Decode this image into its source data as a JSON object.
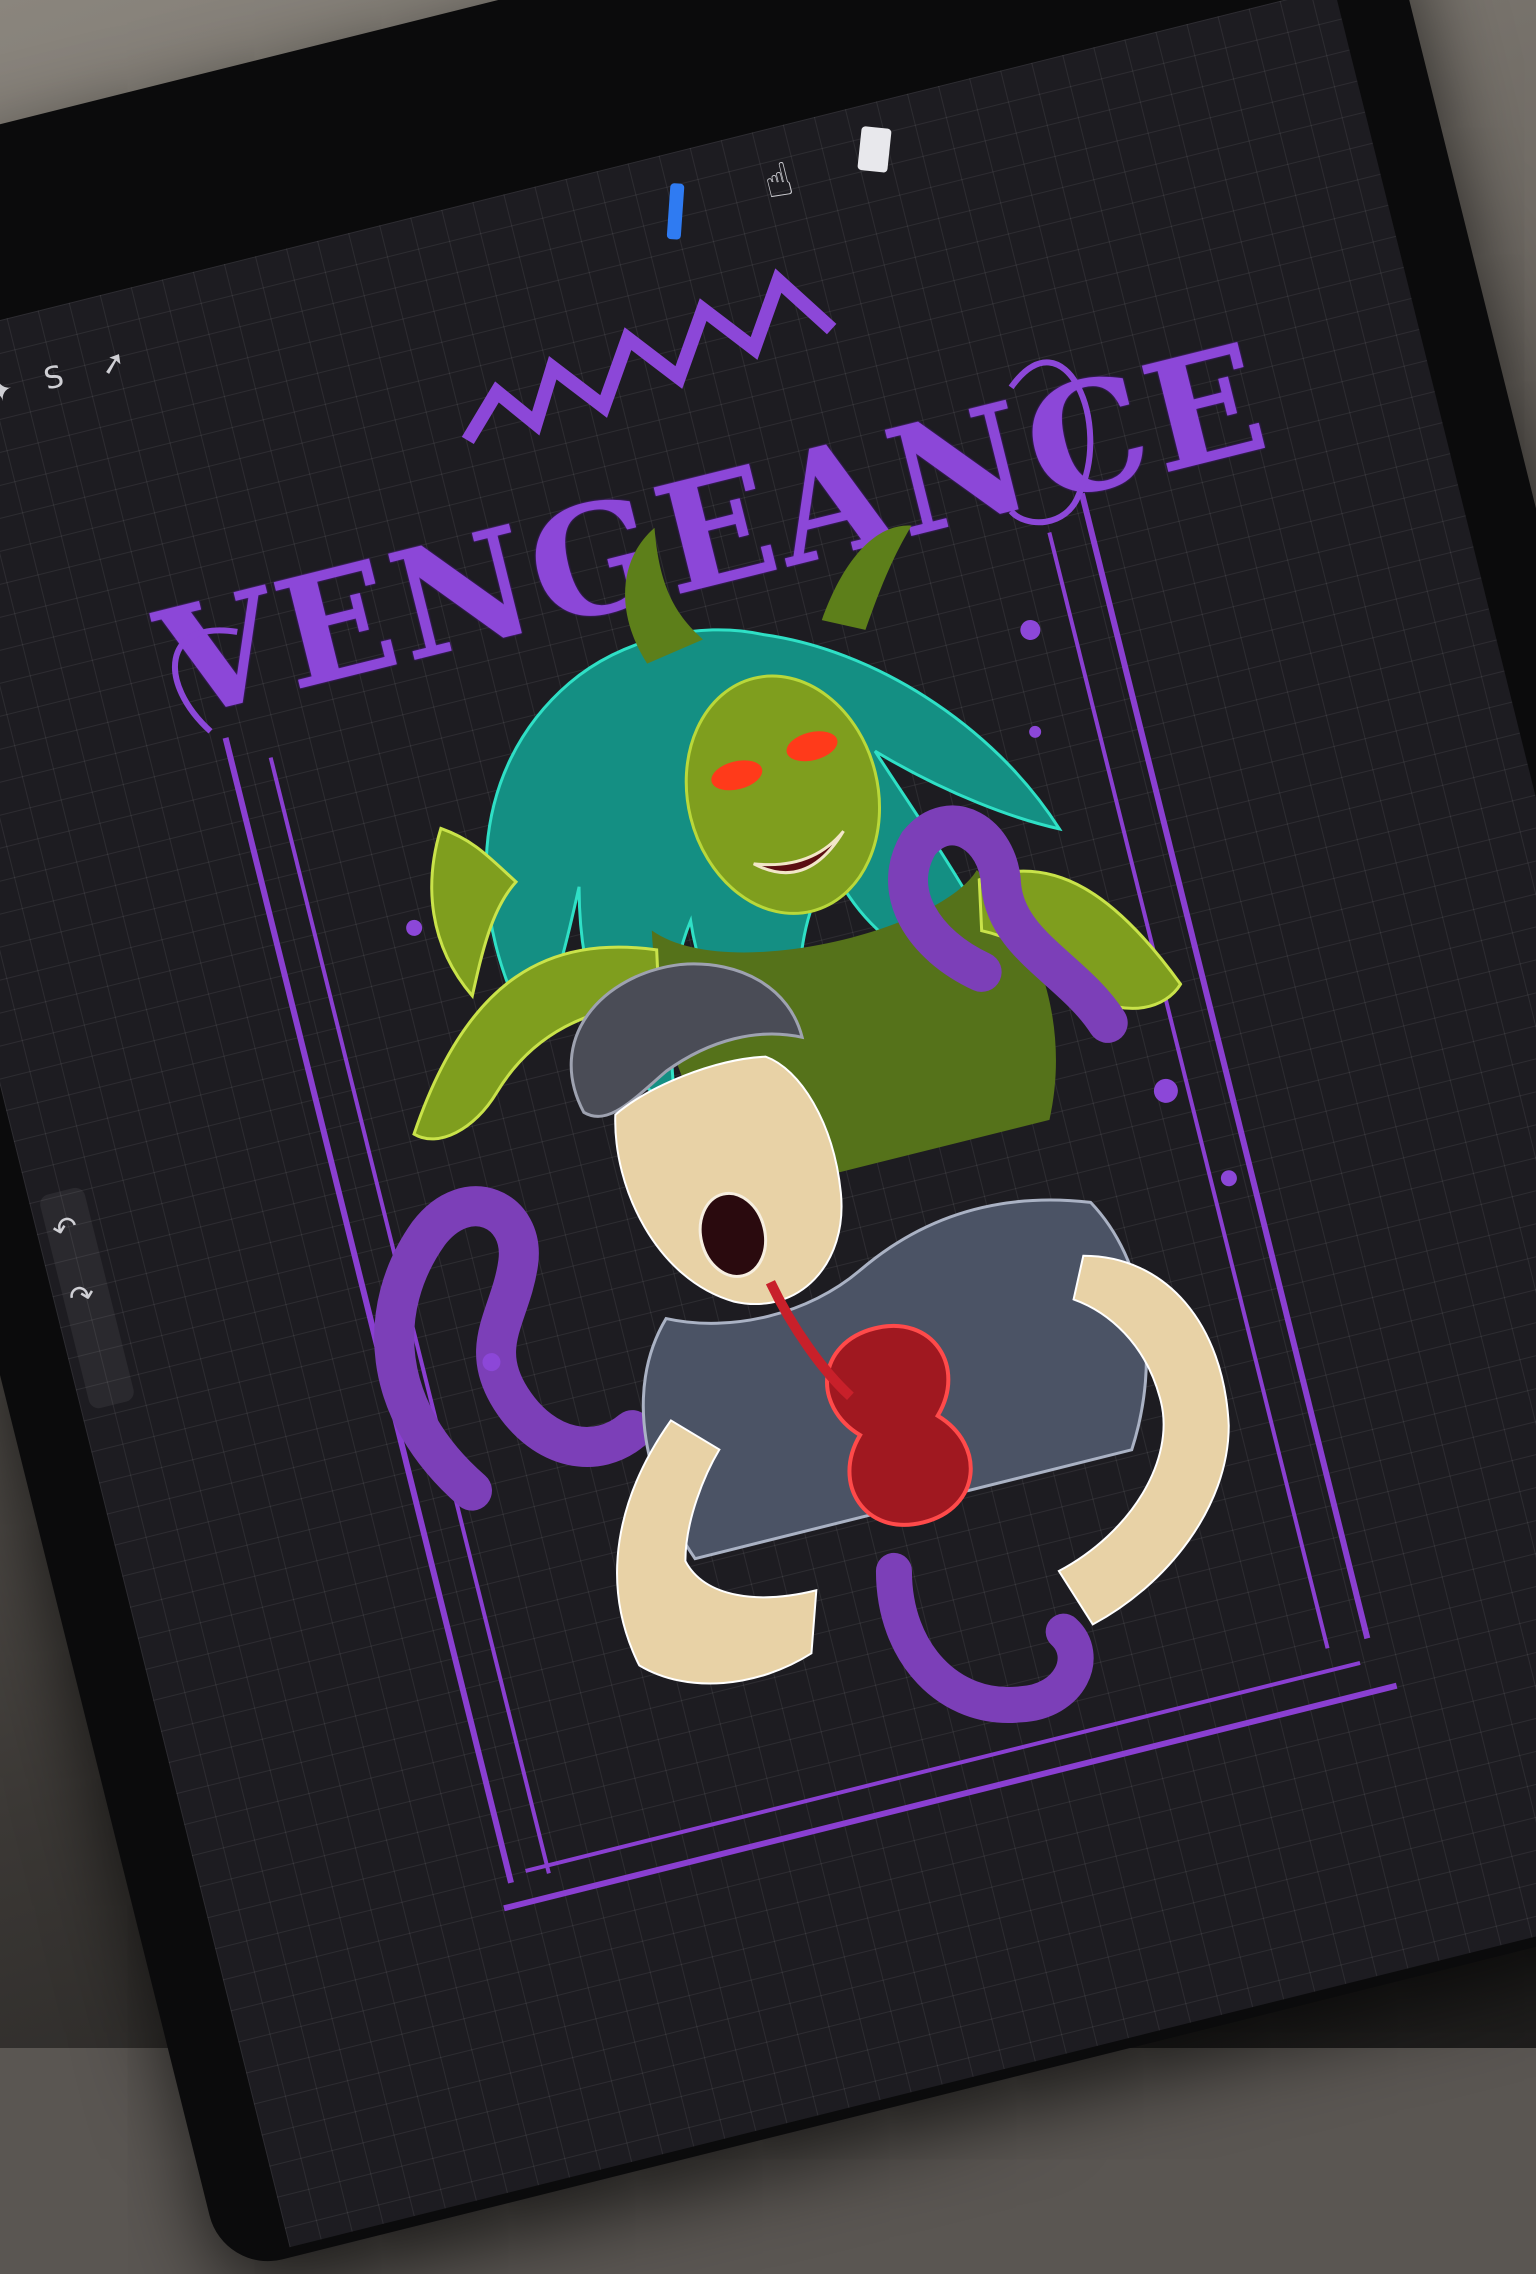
{
  "app": {
    "toolbar": {
      "icons": [
        "wrench-icon",
        "magic-wand-icon",
        "selection-icon",
        "transform-cursor-icon",
        "brush-icon",
        "smudge-icon",
        "eraser-icon"
      ]
    },
    "sidebar": {
      "icons": [
        "undo-icon",
        "redo-icon"
      ]
    },
    "colors": {
      "accent_brush": "#2f7bf2",
      "canvas_bg": "#1d1c21",
      "frame_purple": "#8a3fd1",
      "witch_green": "#9bbd2a",
      "hair_teal": "#1fb3a2",
      "skin": "#e8d2a6",
      "blood": "#c8202a"
    }
  },
  "artwork": {
    "title": "VENGEANCE"
  }
}
